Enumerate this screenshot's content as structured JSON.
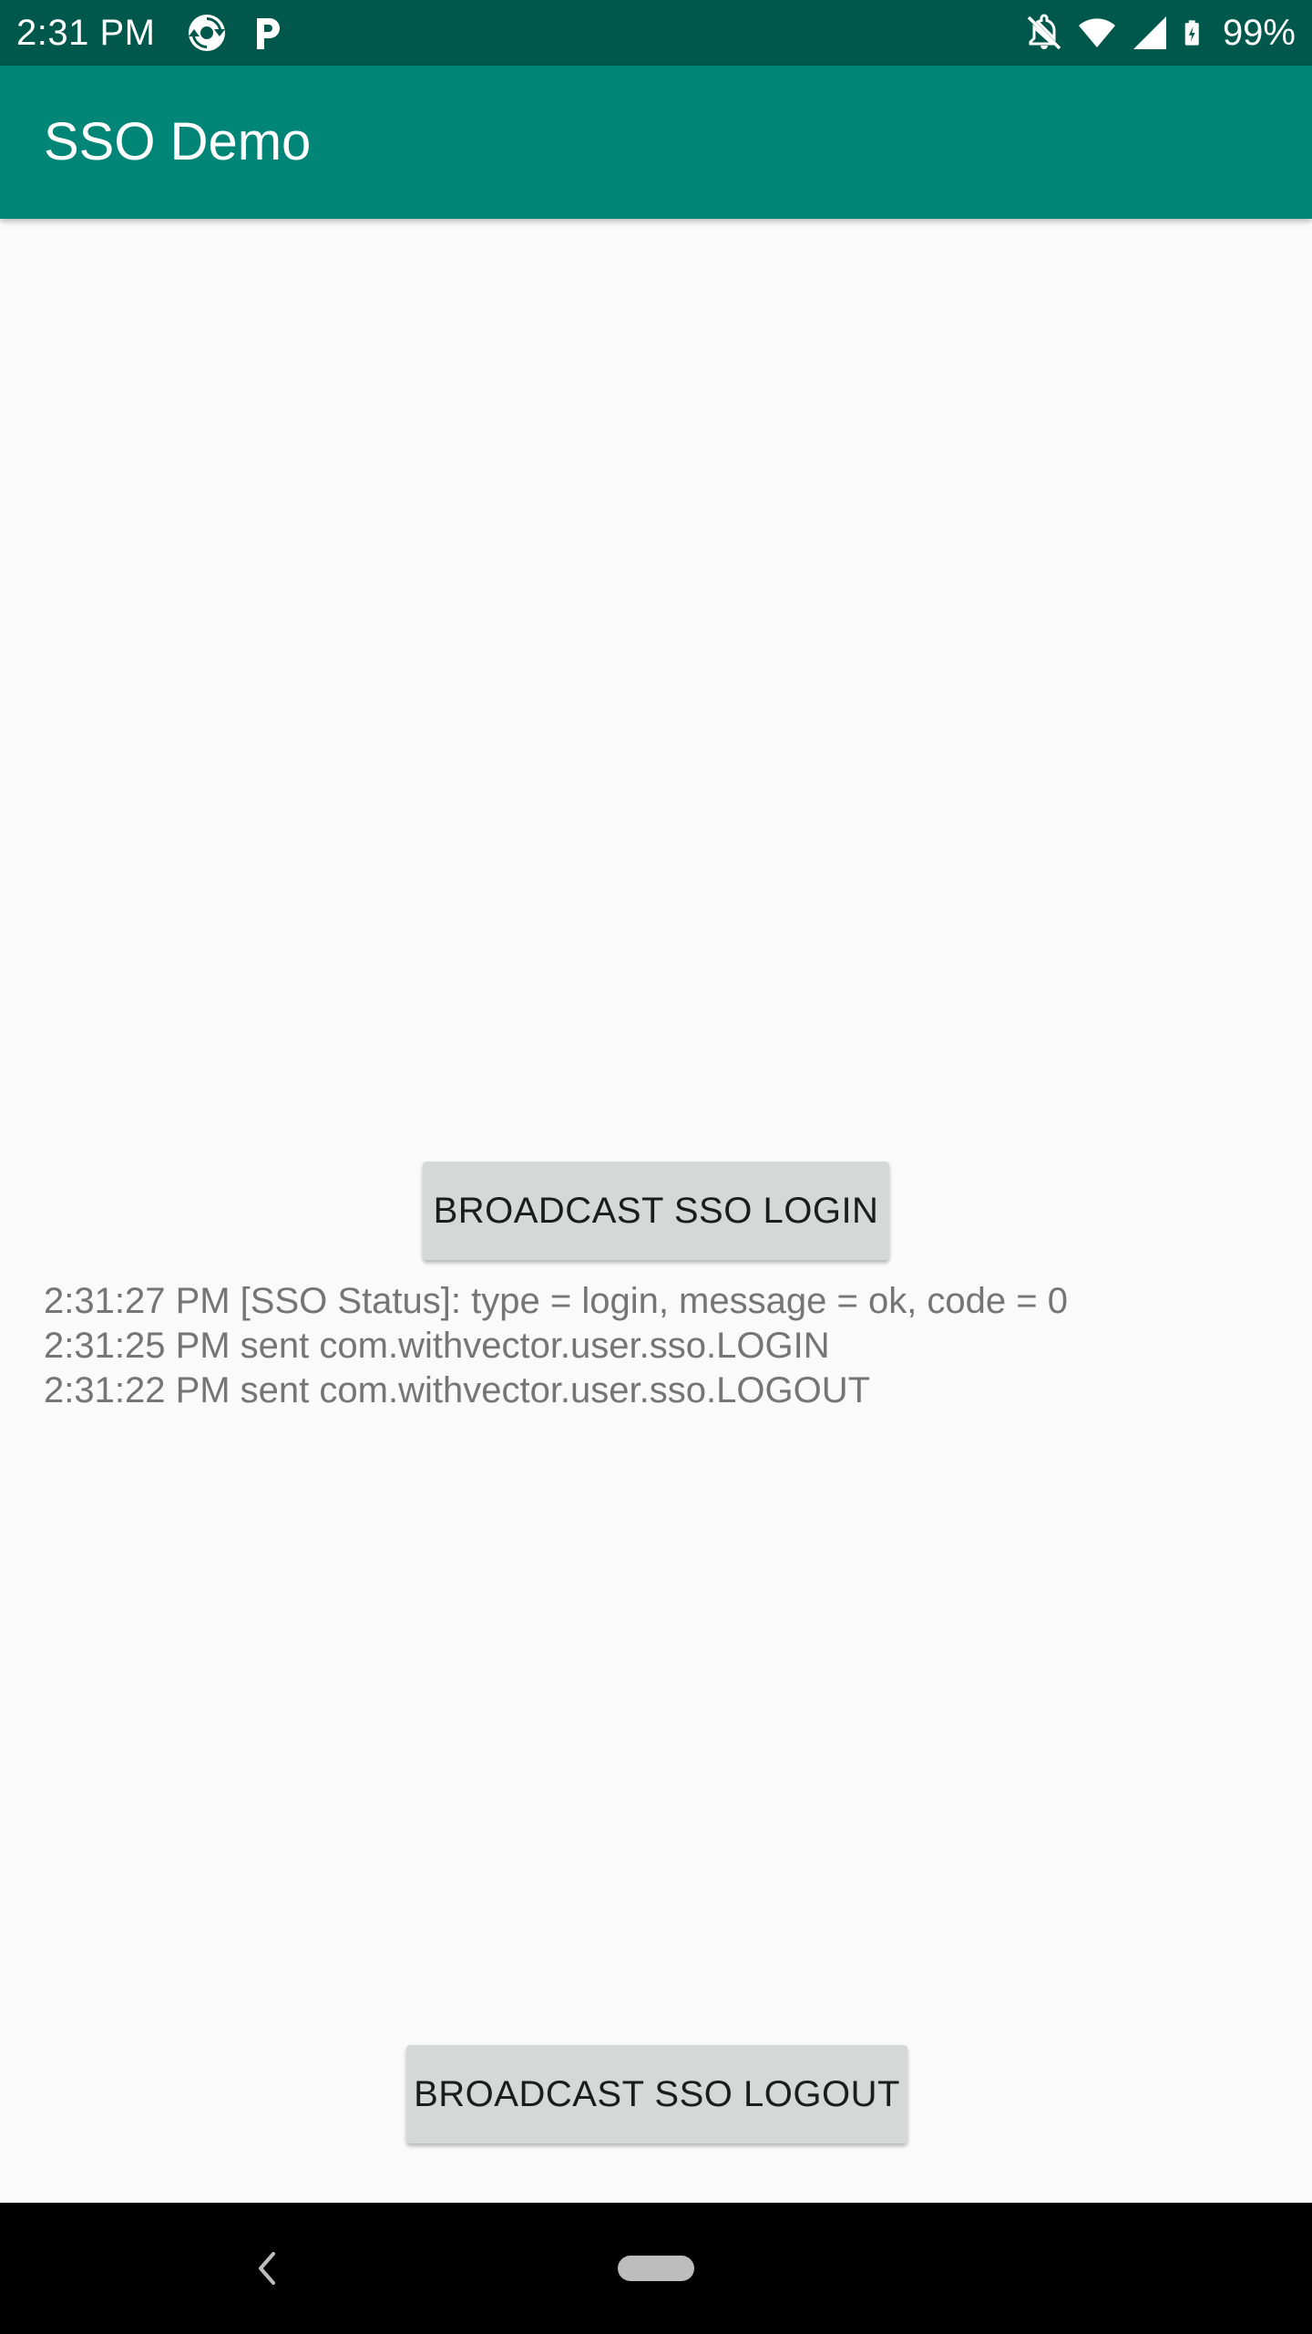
{
  "status_bar": {
    "time": "2:31 PM",
    "battery": "99%",
    "icons": [
      "sync-icon",
      "parking-icon",
      "notifications-off-icon",
      "wifi-icon",
      "cell-signal-icon",
      "battery-charging-icon"
    ]
  },
  "app_bar": {
    "title": "SSO Demo"
  },
  "buttons": {
    "login_label": "BROADCAST SSO LOGIN",
    "logout_label": "BROADCAST SSO LOGOUT"
  },
  "log": [
    "2:31:27 PM [SSO Status]: type = login, message = ok, code = 0",
    "2:31:25 PM sent com.withvector.user.sso.LOGIN",
    "2:31:22 PM sent com.withvector.user.sso.LOGOUT"
  ],
  "nav_bar": {
    "icons": [
      "back-icon",
      "home-pill-icon"
    ]
  },
  "colors": {
    "status_bar": "#00574b",
    "app_bar": "#008577",
    "background": "#fafafa",
    "button": "#d6d7d7",
    "log_text": "#757575"
  }
}
